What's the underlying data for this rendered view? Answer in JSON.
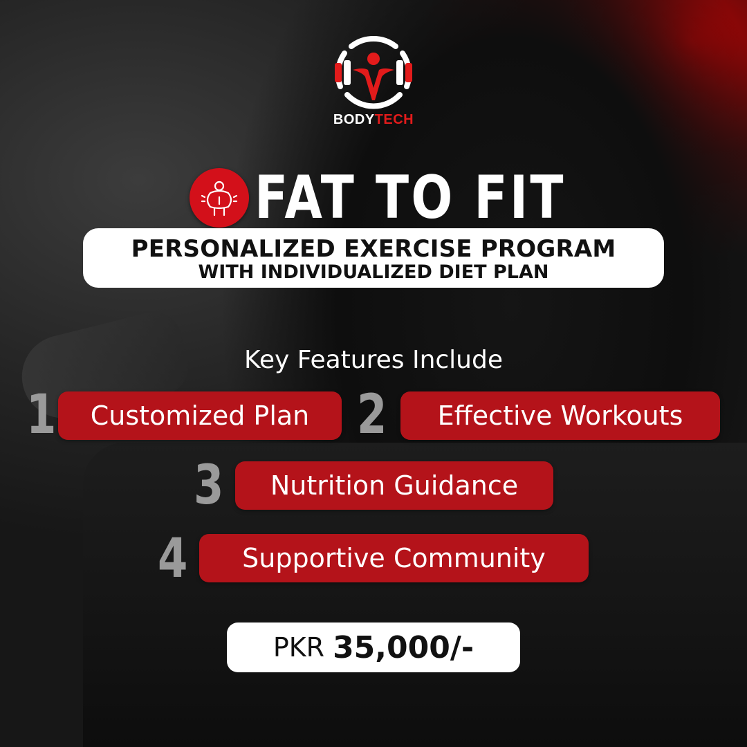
{
  "brand": {
    "name_part1": "BODY",
    "name_part2": "TECH"
  },
  "headline": {
    "title": "FAT TO FIT"
  },
  "subtitle": {
    "line1": "PERSONALIZED EXERCISE PROGRAM",
    "line2": "WITH INDIVIDUALIZED DIET PLAN"
  },
  "features": {
    "title": "Key Features Include",
    "items": [
      {
        "number": "1",
        "label": "Customized Plan"
      },
      {
        "number": "2",
        "label": "Effective Workouts"
      },
      {
        "number": "3",
        "label": "Nutrition Guidance"
      },
      {
        "number": "4",
        "label": "Supportive Community"
      }
    ]
  },
  "price": {
    "currency": "PKR",
    "amount": "35,000/-"
  },
  "colors": {
    "accent_red": "#b4131a",
    "brand_red": "#e21b1b",
    "white": "#ffffff"
  },
  "icons": {
    "logo": "dumbbell-person-logo-icon",
    "badge": "body-weight-icon"
  }
}
